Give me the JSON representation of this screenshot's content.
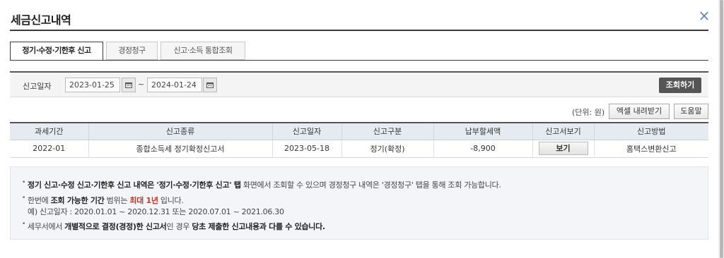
{
  "modal": {
    "title": "세금신고내역",
    "close": "×"
  },
  "tabs": [
    "정기·수정·기한후 신고",
    "경정청구",
    "신고·소득 통합조회"
  ],
  "search": {
    "label": "신고일자",
    "date_from": "2023-01-25",
    "date_to": "2024-01-24",
    "separator": "~",
    "query_button": "조회하기"
  },
  "toolbar": {
    "unit": "(단위: 원)",
    "excel_button": "엑셀 내려받기",
    "help_button": "도움말"
  },
  "table": {
    "headers": [
      "과세기간",
      "신고종류",
      "신고일자",
      "신고구분",
      "납부할세액",
      "신고서보기",
      "신고방법"
    ],
    "rows": [
      {
        "period": "2022-01",
        "kind": "종합소득세 정기확정신고서",
        "date": "2023-05-18",
        "type": "정기(확정)",
        "tax": "-8,900",
        "view": "보기",
        "method": "홈택스변환신고"
      }
    ]
  },
  "notice": {
    "line1_bold_a": "정기 신고·수정 신고·기한후 신고 내역은",
    "line1_bold_b": " '정기·수정·기한후 신고' 탭",
    "line1_rest": " 화면에서 조회할 수 있으며 경정청구 내역은  '경정청구' 탭을 통해 조회 가능합니다.",
    "line2_a": "한번에 ",
    "line2_bold": "조회 가능한 기간",
    "line2_b": " 범위는 ",
    "line2_red": "최대 1년",
    "line2_c": " 입니다.",
    "line3": "예) 신고일자 : 2020.01.01 ~ 2020.12.31 또는 2020.07.01 ~ 2021.06.30",
    "line4_a": "세무서에서 ",
    "line4_bold1": "개별적으로 결정(경정)한 신고서",
    "line4_b": "인 경우 ",
    "line4_bold2": "당초 제출한 신고내용과 다를 수 있습니다."
  }
}
